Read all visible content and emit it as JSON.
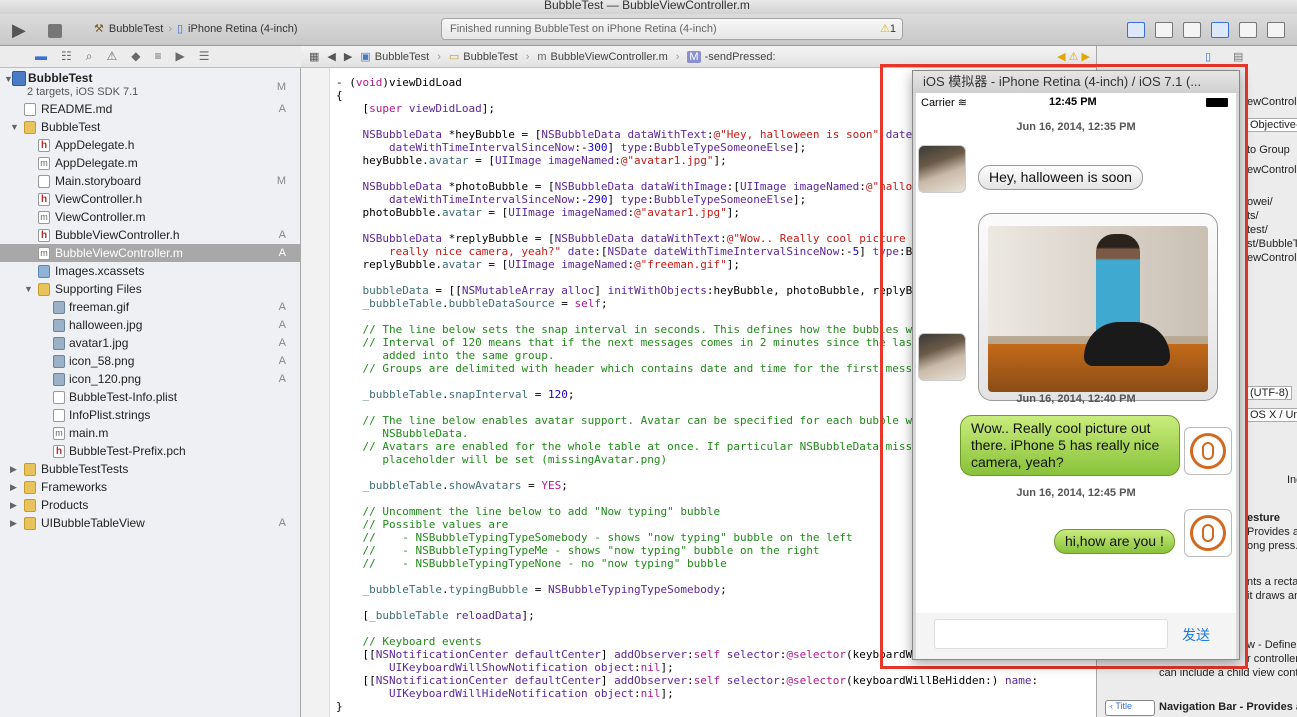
{
  "window": {
    "title_project": "BubbleTest",
    "title_dash": "—",
    "title_file": "BubbleViewController.m"
  },
  "toolbar": {
    "scheme": "BubbleTest",
    "device": "iPhone Retina (4-inch)",
    "status": "Finished running BubbleTest on iPhone Retina (4-inch)",
    "warnings": "1"
  },
  "navigator": {
    "project_name": "BubbleTest",
    "project_sub": "2 targets, iOS SDK 7.1",
    "items": [
      {
        "label": "README.md",
        "badge": "A"
      },
      {
        "label": "BubbleTest",
        "badge": ""
      },
      {
        "label": "AppDelegate.h",
        "badge": ""
      },
      {
        "label": "AppDelegate.m",
        "badge": ""
      },
      {
        "label": "Main.storyboard",
        "badge": "M"
      },
      {
        "label": "ViewController.h",
        "badge": ""
      },
      {
        "label": "ViewController.m",
        "badge": ""
      },
      {
        "label": "BubbleViewController.h",
        "badge": "A"
      },
      {
        "label": "BubbleViewController.m",
        "badge": "A"
      },
      {
        "label": "Images.xcassets",
        "badge": ""
      },
      {
        "label": "Supporting Files",
        "badge": ""
      },
      {
        "label": "freeman.gif",
        "badge": "A"
      },
      {
        "label": "halloween.jpg",
        "badge": "A"
      },
      {
        "label": "avatar1.jpg",
        "badge": "A"
      },
      {
        "label": "icon_58.png",
        "badge": "A"
      },
      {
        "label": "icon_120.png",
        "badge": "A"
      },
      {
        "label": "BubbleTest-Info.plist",
        "badge": ""
      },
      {
        "label": "InfoPlist.strings",
        "badge": ""
      },
      {
        "label": "main.m",
        "badge": ""
      },
      {
        "label": "BubbleTest-Prefix.pch",
        "badge": ""
      },
      {
        "label": "BubbleTestTests",
        "badge": ""
      },
      {
        "label": "Frameworks",
        "badge": ""
      },
      {
        "label": "Products",
        "badge": ""
      },
      {
        "label": "UIBubbleTableView",
        "badge": "A"
      }
    ],
    "project_badge": "M"
  },
  "jumpbar": {
    "crumbs": [
      "BubbleTest",
      "BubbleTest",
      "BubbleViewController.m",
      "-sendPressed:"
    ]
  },
  "inspector": {
    "lines": [
      "ewControlle",
      "Objective-",
      "to Group",
      "ewControlle",
      "owei/",
      "ts/",
      "test/",
      "st/BubbleTe",
      "ewControlle",
      "(UTF-8)",
      "OS X / Uni",
      "Inde",
      "esture",
      "Provides a",
      "ong press...",
      "nts a rectang",
      "it draws and",
      "w - Defines a",
      "r controller th",
      "can include a child view cont",
      "Navigation Bar - Provides a"
    ]
  },
  "simulator": {
    "title": "iOS 模拟器 - iPhone Retina (4-inch) / iOS 7.1 (...",
    "carrier": "Carrier",
    "time": "12:45 PM",
    "date1": "Jun 16, 2014, 12:35 PM",
    "msg1": "Hey, halloween is soon",
    "date2": "Jun 16, 2014, 12:40 PM",
    "msg2": "Wow.. Really cool picture out there. iPhone 5 has really nice camera, yeah?",
    "date3": "Jun 16, 2014, 12:45 PM",
    "msg3": "hi,how are you !",
    "send": "发送"
  }
}
